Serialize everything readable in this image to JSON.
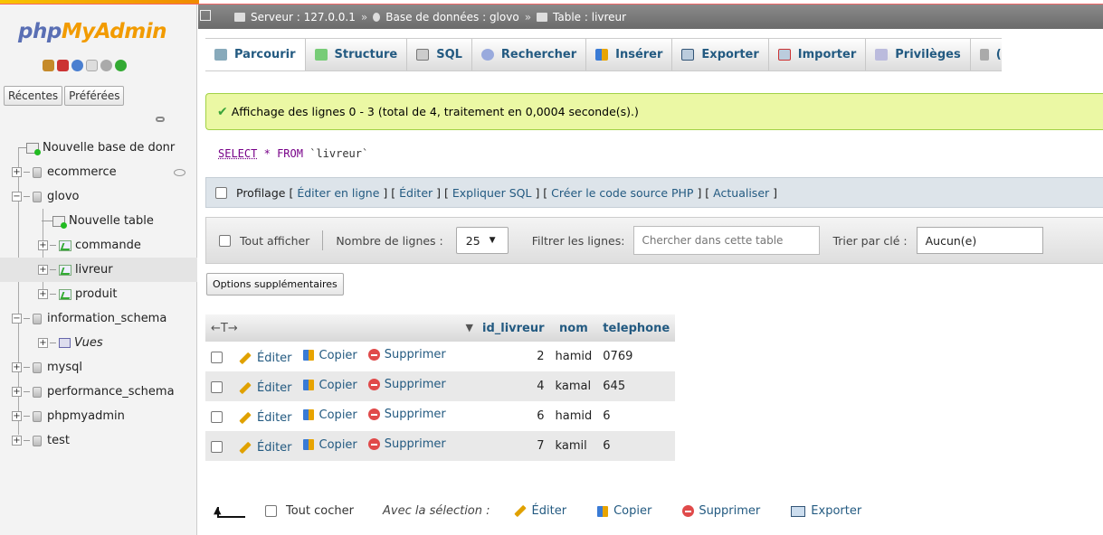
{
  "brand": {
    "php": "php",
    "myadmin": "MyAdmin"
  },
  "nav": {
    "tabs": [
      "Récentes",
      "Préférées"
    ],
    "tree": [
      {
        "label": "Nouvelle base de donr",
        "kind": "new"
      },
      {
        "label": "ecommerce",
        "kind": "db"
      },
      {
        "label": "glovo",
        "kind": "db"
      },
      {
        "label": "Nouvelle table",
        "kind": "newtable"
      },
      {
        "label": "commande",
        "kind": "table"
      },
      {
        "label": "livreur",
        "kind": "table"
      },
      {
        "label": "produit",
        "kind": "table"
      },
      {
        "label": "information_schema",
        "kind": "db"
      },
      {
        "label": "Vues",
        "kind": "views"
      },
      {
        "label": "mysql",
        "kind": "db"
      },
      {
        "label": "performance_schema",
        "kind": "db"
      },
      {
        "label": "phpmyadmin",
        "kind": "db"
      },
      {
        "label": "test",
        "kind": "db"
      }
    ]
  },
  "breadcrumb": {
    "server": "Serveur : 127.0.0.1",
    "sep": "»",
    "database": "Base de données : glovo",
    "table": "Table : livreur"
  },
  "menu": [
    "Parcourir",
    "Structure",
    "SQL",
    "Rechercher",
    "Insérer",
    "Exporter",
    "Importer",
    "Privilèges",
    "("
  ],
  "success": "Affichage des lignes 0 - 3 (total de 4, traitement en 0,0004 seconde(s).)",
  "sql": {
    "select": "SELECT",
    "star": "*",
    "from": "FROM",
    "table": "`livreur`"
  },
  "profiling": {
    "label": "Profilage",
    "lb1": "[",
    "edit_inline": "Éditer en ligne",
    "mid1": "] [",
    "edit": "Éditer",
    "mid2": "] [",
    "explain": "Expliquer SQL",
    "mid3": "] [",
    "php": "Créer le code source PHP",
    "mid4": "] [",
    "refresh": "Actualiser",
    "rb": "]"
  },
  "navbar": {
    "show_all": "Tout afficher",
    "rows_label": "Nombre de lignes :",
    "rows_value": "25",
    "filter_label": "Filtrer les lignes:",
    "filter_placeholder": "Chercher dans cette table",
    "sort_label": "Trier par clé :",
    "sort_value": "Aucun(e)"
  },
  "extra_options": "Options supplémentaires",
  "table": {
    "arrows": "←T→",
    "sort_marker": "▼",
    "columns": [
      "id_livreur",
      "nom",
      "telephone"
    ],
    "actions": {
      "edit": "Éditer",
      "copy": "Copier",
      "delete": "Supprimer"
    },
    "rows": [
      {
        "id_livreur": "2",
        "nom": "hamid",
        "telephone": "0769"
      },
      {
        "id_livreur": "4",
        "nom": "kamal",
        "telephone": "645"
      },
      {
        "id_livreur": "6",
        "nom": "hamid",
        "telephone": "6"
      },
      {
        "id_livreur": "7",
        "nom": "kamil",
        "telephone": "6"
      }
    ]
  },
  "bottom": {
    "check_all": "Tout cocher",
    "with_selection": "Avec la sélection :",
    "edit": "Éditer",
    "copy": "Copier",
    "delete": "Supprimer",
    "export": "Exporter"
  },
  "colors": {
    "link": "#235a81",
    "success_bg": "#ebf8a4",
    "breadcrumb_bg": "#6b6b6b"
  }
}
